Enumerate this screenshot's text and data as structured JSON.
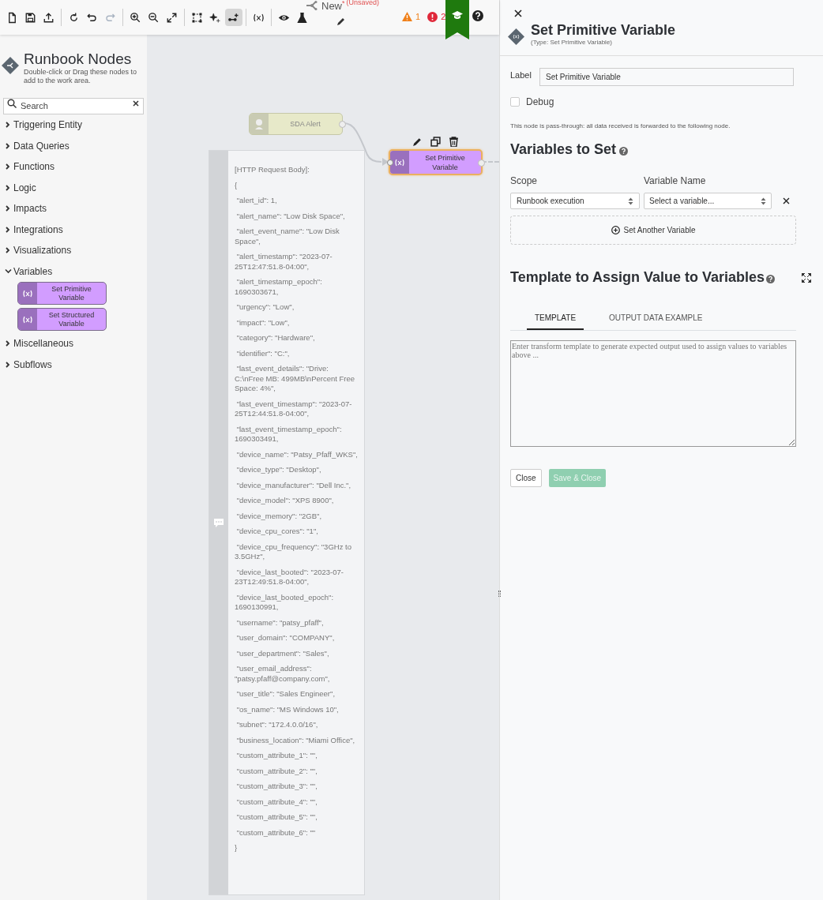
{
  "toolbar": {
    "tools": [
      {
        "kind": "new-file",
        "selected": false,
        "disabled": false
      },
      {
        "kind": "save",
        "selected": false,
        "disabled": false
      },
      {
        "kind": "upload",
        "selected": false,
        "disabled": false
      },
      {
        "kind": "sep"
      },
      {
        "kind": "reload",
        "selected": false,
        "disabled": false
      },
      {
        "kind": "undo",
        "selected": false,
        "disabled": false
      },
      {
        "kind": "redo",
        "selected": false,
        "disabled": true
      },
      {
        "kind": "sep"
      },
      {
        "kind": "zoom-in",
        "selected": false,
        "disabled": false
      },
      {
        "kind": "zoom-out",
        "selected": false,
        "disabled": false
      },
      {
        "kind": "fit",
        "selected": false,
        "disabled": false
      },
      {
        "kind": "sep"
      },
      {
        "kind": "select",
        "selected": false,
        "disabled": false
      },
      {
        "kind": "sparkle",
        "selected": false,
        "disabled": false
      },
      {
        "kind": "connect",
        "selected": true,
        "disabled": false
      },
      {
        "kind": "sep"
      },
      {
        "kind": "variable",
        "selected": false,
        "disabled": false
      },
      {
        "kind": "sep"
      },
      {
        "kind": "preview",
        "selected": false,
        "disabled": false
      },
      {
        "kind": "test",
        "selected": false,
        "disabled": false
      }
    ],
    "title": "New",
    "modified_mark": "*",
    "save_state": "(Unsaved)",
    "warnings": "1",
    "errors": "2"
  },
  "sidebar": {
    "title": "Runbook Nodes",
    "subtitle": "Double-click or Drag these nodes to add to the work area.",
    "search": {
      "placeholder": "Search"
    },
    "categories": [
      {
        "label": "Triggering Entity",
        "expanded": false
      },
      {
        "label": "Data Queries",
        "expanded": false
      },
      {
        "label": "Functions",
        "expanded": false
      },
      {
        "label": "Logic",
        "expanded": false
      },
      {
        "label": "Impacts",
        "expanded": false
      },
      {
        "label": "Integrations",
        "expanded": false
      },
      {
        "label": "Visualizations",
        "expanded": false
      },
      {
        "label": "Variables",
        "expanded": true,
        "children": [
          {
            "label": "Set Primitive Variable"
          },
          {
            "label": "Set Structured Variable"
          }
        ]
      },
      {
        "label": "Miscellaneous",
        "expanded": false
      },
      {
        "label": "Subflows",
        "expanded": false
      }
    ]
  },
  "canvas": {
    "nodes": [
      {
        "kind": "trigger",
        "label": "SDA Alert",
        "selected": false
      },
      {
        "kind": "variable",
        "label": "Set Primitive Variable",
        "selected": true
      }
    ],
    "note": {
      "lines": [
        "[HTTP Request Body]:",
        "{",
        " \"alert_id\": 1,",
        " \"alert_name\": \"Low Disk Space\",",
        " \"alert_event_name\": \"Low Disk Space\",",
        " \"alert_timestamp\": \"2023-07-25T12:47:51.8-04:00\",",
        " \"alert_timestamp_epoch\": 1690303671,",
        " \"urgency\": \"Low\",",
        " \"impact\": \"Low\",",
        " \"category\": \"Hardware\",",
        " \"identifier\": \"C:\",",
        " \"last_event_details\": \"Drive: C:\\nFree MB: 499MB\\nPercent Free Space: 4%\",",
        " \"last_event_timestamp\": \"2023-07-25T12:44:51.8-04:00\",",
        " \"last_event_timestamp_epoch\": 1690303491,",
        " \"device_name\": \"Patsy_Pfaff_WKS\",",
        " \"device_type\": \"Desktop\",",
        " \"device_manufacturer\": \"Dell Inc.\",",
        " \"device_model\": \"XPS 8900\",",
        " \"device_memory\": \"2GB\",",
        " \"device_cpu_cores\": \"1\",",
        " \"device_cpu_frequency\": \"3GHz to 3.5GHz\",",
        " \"device_last_booted\": \"2023-07-23T12:49:51.8-04:00\",",
        " \"device_last_booted_epoch\": 1690130991,",
        " \"username\": \"patsy_pfaff\",",
        " \"user_domain\": \"COMPANY\",",
        " \"user_department\": \"Sales\",",
        " \"user_email_address\": \"patsy.pfaff@company.com\",",
        " \"user_title\": \"Sales Engineer\",",
        " \"os_name\": \"MS Windows 10\",",
        " \"subnet\": \"172.4.0.0/16\",",
        " \"business_location\": \"Miami Office\",",
        " \"custom_attribute_1\": \"\",",
        " \"custom_attribute_2\": \"\",",
        " \"custom_attribute_3\": \"\",",
        " \"custom_attribute_4\": \"\",",
        " \"custom_attribute_5\": \"\",",
        " \"custom_attribute_6\": \"\"",
        "}"
      ]
    }
  },
  "panel": {
    "title": "Set Primitive Variable",
    "type_label": "(Type: Set Primitive Variable)",
    "label_field": {
      "label": "Label",
      "value": "Set Primitive Variable"
    },
    "debug": {
      "label": "Debug",
      "checked": false
    },
    "info": "This node is pass-through: all data received is forwarded to the following node.",
    "variables_heading": "Variables to Set",
    "scope_label": "Scope",
    "name_label": "Variable Name",
    "rows": [
      {
        "scope": "Runbook execution",
        "name": "Select a variable..."
      }
    ],
    "add_button": "Set Another Variable",
    "template_heading": "Template to Assign Value to Variables",
    "tabs": [
      {
        "label": "TEMPLATE",
        "selected": true
      },
      {
        "label": "OUTPUT DATA EXAMPLE",
        "selected": false
      }
    ],
    "template": {
      "placeholder": "Enter transform template to generate expected output used to assign values to variables above ..."
    },
    "buttons": [
      {
        "kind": "secondary",
        "label": "Close",
        "disabled": false
      },
      {
        "kind": "primary",
        "label": "Save & Close",
        "disabled": true
      }
    ]
  }
}
